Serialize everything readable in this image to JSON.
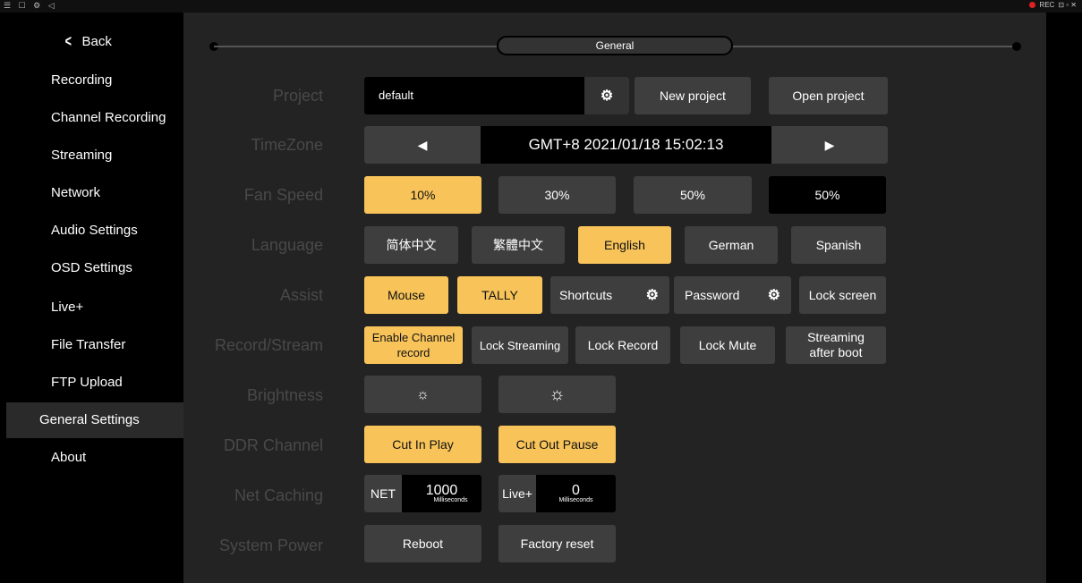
{
  "topbar": {
    "icons": "☰ ☐ ⚙ ◁",
    "rec_label": "REC",
    "window_controls": "⊡ ▫ ✕"
  },
  "sidebar": {
    "back_label": "Back",
    "items": [
      {
        "label": "Recording"
      },
      {
        "label": "Channel Recording"
      },
      {
        "label": "Streaming"
      },
      {
        "label": "Network"
      },
      {
        "label": "Audio Settings"
      },
      {
        "label": "OSD Settings"
      },
      {
        "label": "Live+"
      },
      {
        "label": "File Transfer"
      },
      {
        "label": "FTP Upload"
      },
      {
        "label": "General Settings",
        "active": true
      },
      {
        "label": "About"
      }
    ]
  },
  "main": {
    "section_title": "General",
    "labels": {
      "project": "Project",
      "timezone": "TimeZone",
      "fan_speed": "Fan Speed",
      "language": "Language",
      "assist": "Assist",
      "record_stream": "Record/Stream",
      "brightness": "Brightness",
      "ddr_channel": "DDR Channel",
      "net_caching": "Net Caching",
      "system_power": "System Power"
    },
    "project": {
      "value": "default",
      "new_label": "New project",
      "open_label": "Open project"
    },
    "timezone": {
      "prev": "◀",
      "value": "GMT+8 2021/01/18 15:02:13",
      "next": "▶"
    },
    "fan_speed": {
      "options": [
        "10%",
        "30%",
        "50%"
      ],
      "selected": "10%",
      "current": "50%"
    },
    "language": {
      "options": [
        "简体中文",
        "繁體中文",
        "English",
        "German",
        "Spanish"
      ],
      "selected": "English"
    },
    "assist": {
      "mouse": "Mouse",
      "tally": "TALLY",
      "shortcuts": "Shortcuts",
      "password": "Password",
      "lock_screen": "Lock screen"
    },
    "record_stream": {
      "enable_channel_record": "Enable Channel record",
      "lock_streaming": "Lock Streaming",
      "lock_record": "Lock Record",
      "lock_mute": "Lock Mute",
      "streaming_after_boot": "Streaming after boot"
    },
    "ddr_channel": {
      "cut_in_play": "Cut In Play",
      "cut_out_pause": "Cut Out Pause"
    },
    "net_caching": {
      "net_tag": "NET",
      "net_value": "1000",
      "net_unit": "Milliseconds",
      "live_tag": "Live+",
      "live_value": "0",
      "live_unit": "Milliseconds"
    },
    "system_power": {
      "reboot": "Reboot",
      "factory_reset": "Factory reset"
    }
  },
  "colors": {
    "accent": "#f8c45a",
    "button": "#3e3e3e",
    "panel": "#232323",
    "label": "#494949"
  }
}
